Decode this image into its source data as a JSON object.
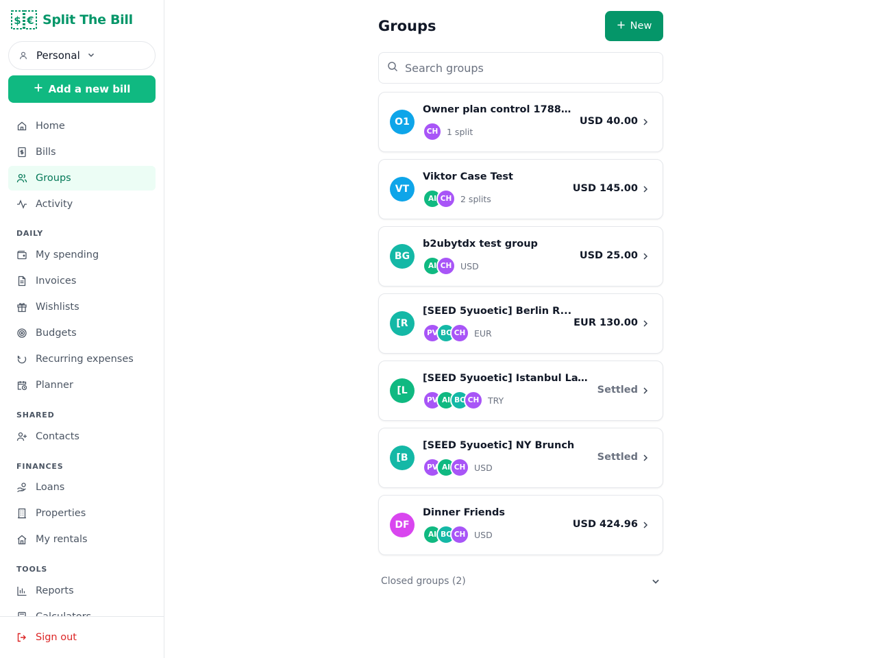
{
  "app": {
    "name": "Split The Bill"
  },
  "sidebar": {
    "profile_label": "Personal",
    "add_bill_label": "Add a new bill",
    "main_items": [
      {
        "label": "Home",
        "icon": "home-icon"
      },
      {
        "label": "Bills",
        "icon": "receipt-icon"
      },
      {
        "label": "Groups",
        "icon": "users-icon",
        "active": true
      },
      {
        "label": "Activity",
        "icon": "activity-icon"
      }
    ],
    "sections": {
      "daily": "DAILY",
      "shared": "SHARED",
      "finances": "FINANCES",
      "tools": "TOOLS"
    },
    "daily_items": [
      {
        "label": "My spending",
        "icon": "wallet-icon"
      },
      {
        "label": "Invoices",
        "icon": "file-icon"
      },
      {
        "label": "Wishlists",
        "icon": "gift-icon"
      },
      {
        "label": "Budgets",
        "icon": "target-icon"
      },
      {
        "label": "Recurring expenses",
        "icon": "refresh-icon"
      },
      {
        "label": "Planner",
        "icon": "calendar-clock-icon"
      }
    ],
    "shared_items": [
      {
        "label": "Contacts",
        "icon": "user-plus-icon"
      }
    ],
    "finances_items": [
      {
        "label": "Loans",
        "icon": "hand-coins-icon"
      },
      {
        "label": "Properties",
        "icon": "building-icon"
      },
      {
        "label": "My rentals",
        "icon": "house-icon"
      }
    ],
    "tools_items": [
      {
        "label": "Reports",
        "icon": "bar-chart-icon"
      },
      {
        "label": "Calculators",
        "icon": "calculator-icon"
      }
    ],
    "sign_out_label": "Sign out"
  },
  "header": {
    "title": "Groups",
    "new_button_label": "New"
  },
  "search": {
    "placeholder": "Search groups"
  },
  "groups": [
    {
      "initials": "O1",
      "name": "Owner plan control 17886...",
      "avatar_color": "#0ea5e9",
      "members": [
        {
          "initials": "CH",
          "color": "#a855f7"
        }
      ],
      "meta": "1 split",
      "amount": "USD 40.00",
      "settled": false
    },
    {
      "initials": "VT",
      "name": "Viktor Case Test",
      "avatar_color": "#0ea5e9",
      "members": [
        {
          "initials": "AI",
          "color": "#10b981"
        },
        {
          "initials": "CH",
          "color": "#a855f7"
        }
      ],
      "meta": "2 splits",
      "amount": "USD 145.00",
      "settled": false
    },
    {
      "initials": "BG",
      "name": "b2ubytdx test group",
      "avatar_color": "#14b8a6",
      "members": [
        {
          "initials": "AI",
          "color": "#10b981"
        },
        {
          "initials": "CH",
          "color": "#a855f7"
        }
      ],
      "meta": "USD",
      "amount": "USD 25.00",
      "settled": false
    },
    {
      "initials": "[R",
      "name": "[SEED 5yuoetic] Berlin R...",
      "avatar_color": "#14b8a6",
      "members": [
        {
          "initials": "PV",
          "color": "#a855f7"
        },
        {
          "initials": "BC",
          "color": "#14b8a6"
        },
        {
          "initials": "CH",
          "color": "#a855f7"
        }
      ],
      "meta": "EUR",
      "amount": "EUR 130.00",
      "settled": false
    },
    {
      "initials": "[L",
      "name": "[SEED 5yuoetic] Istanbul Lay...",
      "avatar_color": "#10b981",
      "members": [
        {
          "initials": "PV",
          "color": "#a855f7"
        },
        {
          "initials": "AI",
          "color": "#10b981"
        },
        {
          "initials": "BC",
          "color": "#14b8a6"
        },
        {
          "initials": "CH",
          "color": "#a855f7"
        }
      ],
      "meta": "TRY",
      "amount": "Settled",
      "settled": true
    },
    {
      "initials": "[B",
      "name": "[SEED 5yuoetic] NY Brunch",
      "avatar_color": "#14b8a6",
      "members": [
        {
          "initials": "PV",
          "color": "#a855f7"
        },
        {
          "initials": "AI",
          "color": "#10b981"
        },
        {
          "initials": "CH",
          "color": "#a855f7"
        }
      ],
      "meta": "USD",
      "amount": "Settled",
      "settled": true
    },
    {
      "initials": "DF",
      "name": "Dinner Friends",
      "avatar_color": "#d946ef",
      "members": [
        {
          "initials": "AI",
          "color": "#10b981"
        },
        {
          "initials": "BC",
          "color": "#14b8a6"
        },
        {
          "initials": "CH",
          "color": "#a855f7"
        }
      ],
      "meta": "USD",
      "amount": "USD 424.96",
      "settled": false
    }
  ],
  "closed_groups_label": "Closed groups (2)",
  "colors": {
    "brand": "#059669",
    "accent": "#10b981",
    "danger": "#dc2626"
  }
}
